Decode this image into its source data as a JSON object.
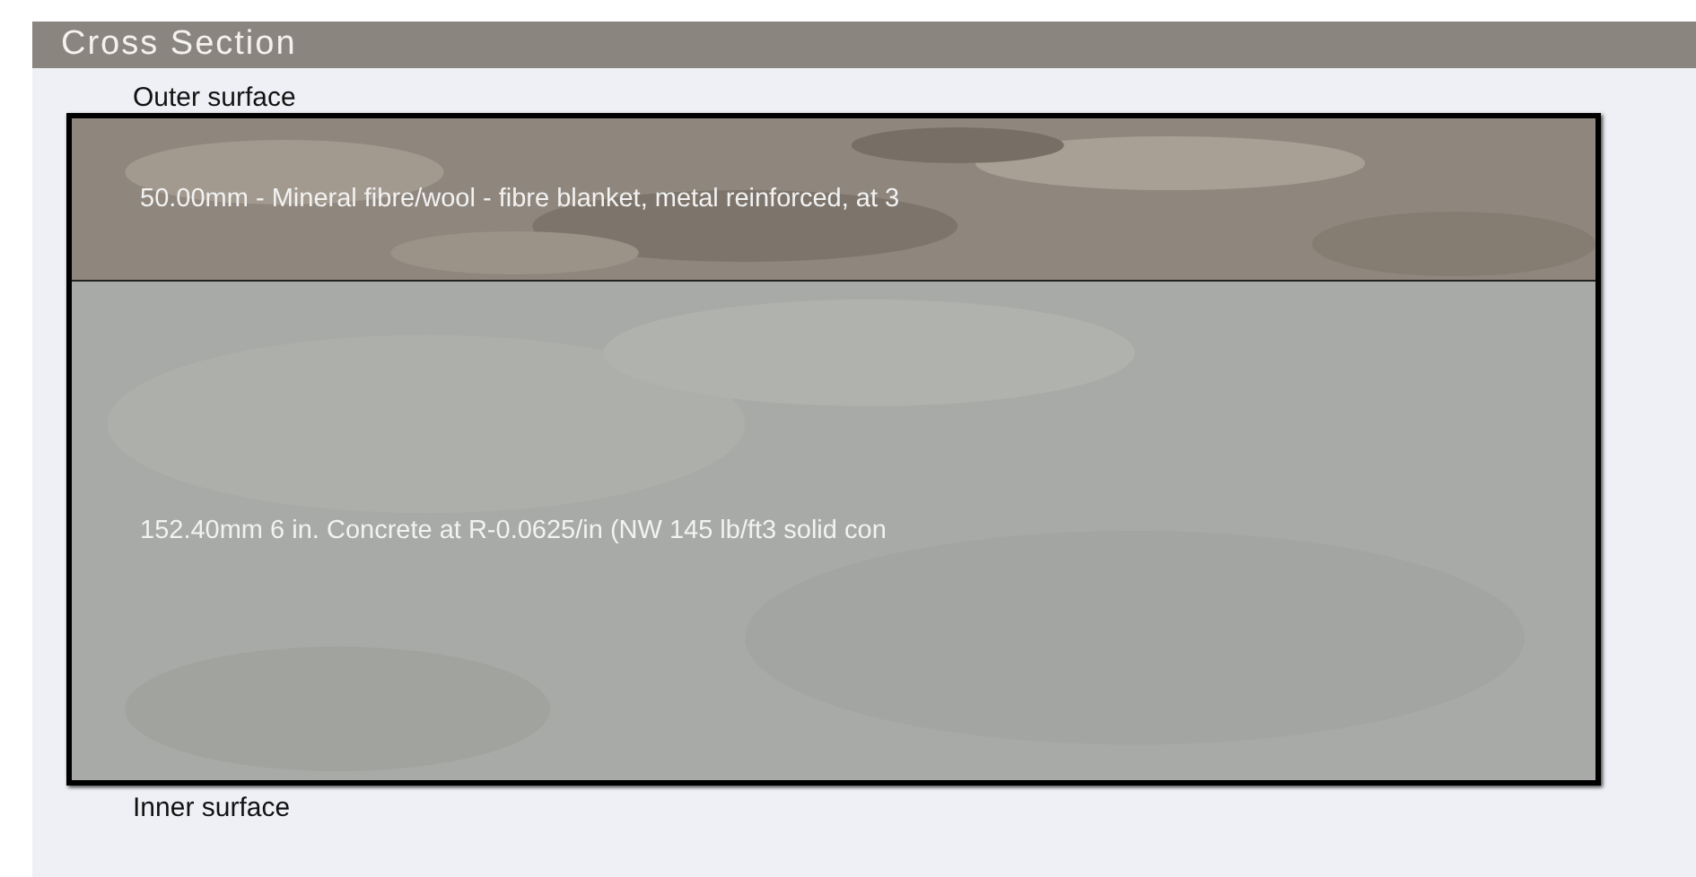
{
  "panel": {
    "title": "Cross Section"
  },
  "outer_label": "Outer surface",
  "layers": [
    {
      "kind": "gravel",
      "text": "50.00mm - Mineral fibre/wool - fibre blanket, metal reinforced, at 3"
    },
    {
      "kind": "concrete",
      "text": "152.40mm 6 in. Concrete at R-0.0625/in (NW 145 lb/ft3 solid con"
    }
  ],
  "inner_label": "Inner surface"
}
